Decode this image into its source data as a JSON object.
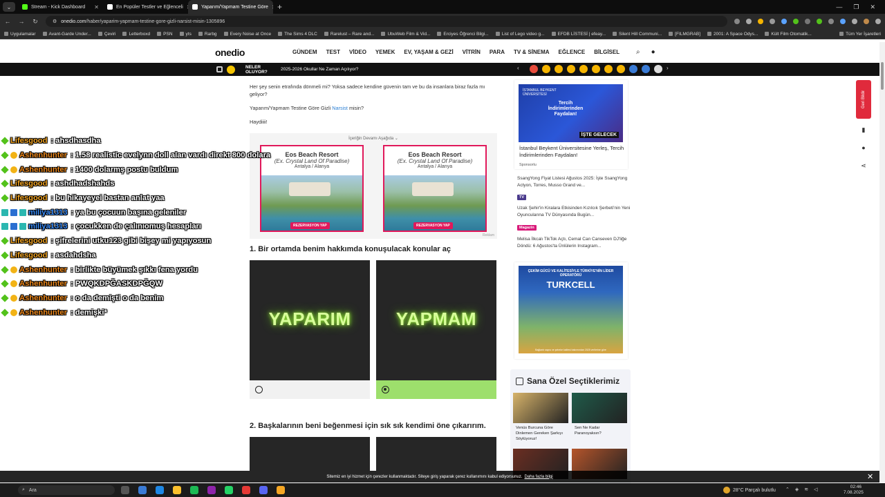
{
  "browser": {
    "tabs": [
      {
        "title": "Stream - Kick Dashboard",
        "color": "#53fc18"
      },
      {
        "title": "En Popüler Testler ve Eğlenceli",
        "color": "#ffffff"
      },
      {
        "title": "Yaparım/Yapmam Testine Göre",
        "color": "#ffffff",
        "active": true
      }
    ],
    "new_tab": "+",
    "address": {
      "host": "onedio.com",
      "path": "/haber/yaparim-yapmam-testine-gore-gizli-narsist-misin-1305896"
    },
    "bookmarks": [
      "Uygulamalar",
      "Avant-Garde Under...",
      "Çeviri",
      "Letterboxd",
      "PSN",
      "yts",
      "Rarbg",
      "Every Noise at Once",
      "The Sims 4 DLC",
      "Rarelust – Rare and...",
      "UbuWeb Film & Vid...",
      "Erciyes Öğrenci Bilgi...",
      "List of Lego video g...",
      "EFDB LİSTESİ | efeay...",
      "Silent Hill Communi...",
      "[FILMGRAB]",
      "2001: A Space Odys...",
      "Kült Film Otomatik..."
    ],
    "bookmarks_right": "Tüm Yer İşaretleri"
  },
  "site": {
    "logo": "onedio",
    "nav": [
      "GÜNDEM",
      "TEST",
      "VİDEO",
      "YEMEK",
      "EV, YAŞAM & GEZİ",
      "VİTRİN",
      "PARA",
      "TV & SİNEMA",
      "EĞLENCE",
      "BİLGİSEL"
    ],
    "ticker_label": "NELER OLUYOR?",
    "ticker_text": "2025-2026 Okullar Ne Zaman Açılıyor?",
    "ticker_emoji_colors": [
      "#e74c3c",
      "#f5b400",
      "#f5b400",
      "#f5b400",
      "#f5b400",
      "#f5b400",
      "#f5b400",
      "#f5b400",
      "#3a7bd5",
      "#3a7bd5",
      "#dddddd"
    ]
  },
  "article": {
    "p1": "Her şey senin etrafında dönmeli mi? Yoksa sadece kendine güvenin tam ve bu da insanlara biraz fazla mı geliyor?",
    "p2_before": "Yaparım/Yapmam Testine Göre Gizli ",
    "p2_link": "Narsist",
    "p2_after": " misin?",
    "p3": "Haydiiii!",
    "ad_continue": "İçeriğin Devamı Aşağıda ⌄",
    "ad": {
      "title": "Eos Beach Resort",
      "subtitle": "(Ex. Crystal Land Of Paradise)",
      "location": "Antalya / Alanya",
      "cta": "REZERVASYON YAP",
      "tag": "Reklam"
    },
    "questions": [
      {
        "title": "1. Bir ortamda benim hakkımda konuşulacak konular aç",
        "options": [
          {
            "label": "YAPARIM",
            "selected": false
          },
          {
            "label": "YAPMAM",
            "selected": true
          }
        ]
      },
      {
        "title": "2. Başkalarının beni beğenmesi için sık sık kendimi öne çıkarırım."
      }
    ]
  },
  "sidebar": {
    "ad1": {
      "badge": "İSTANBUL BEYKENT ÜNİVERSİTESİ",
      "headline": "Tercih İndirimlerinden Faydalan!",
      "stamp": "İŞTE GELECEK",
      "caption": "İstanbul Beykent Üniversitesine Yerleş, Tercih İndirimlerinden Faydalan!",
      "sponsor": "Sponsorlu"
    },
    "items": [
      {
        "text": "SsangYong Fiyat Listesi Ağustos 2025: İşte SsangYong Actyon, Torres, Musso Grand ve..."
      },
      {
        "tag": "TV",
        "tag_color": "#4a3a8c",
        "text": "Uzak Şehir'in Kiralara Etkisinden Kızılcık Şerbeti'nin Yeni Oyuncularına TV Dünyasında Bugün..."
      },
      {
        "tag": "Magazin",
        "tag_color": "#d91a7a",
        "text": "Melisa İlkcalı TikTok Açtı, Cemal Can Canseven DJ'liğe Döndü: 6 Ağustos'ta Ünlülerin Instagram..."
      }
    ],
    "ad2": {
      "top": "ÇEKİM GÜCÜ VE KALİTESİYLE TÜRKİYE'NİN LİDER OPERATÖRÜ",
      "brand": "TURKCELL",
      "foot": "Bağlantı sayısı ve şebeke kalitesi bakımından 2025 verilerine göre"
    },
    "picks_title": "Sana Özel Seçtiklerimiz",
    "picks": [
      {
        "caption": "Venüs Burcuna Göre Dinlemen Gereken Şarkıyı Söylüyoruz!",
        "color": "#d7b36a"
      },
      {
        "caption": "Sen Ne Kadar Paranoyaksın?",
        "color": "#1f5b4a"
      },
      {
        "caption": "",
        "color": "#6b2e22"
      },
      {
        "caption": "",
        "color": "#b5552b"
      }
    ],
    "feedback": "Geri Bildir"
  },
  "chat": [
    {
      "user": "Lifesgood",
      "color": "#f5a623",
      "badges": [
        "green"
      ],
      "msg": ": ahsdhasdha"
    },
    {
      "user": "Ashenhunter",
      "color": "#f08a1c",
      "badges": [
        "green",
        "gold"
      ],
      "msg": ": 1.58 realistic evelynn doll alan vardı direkt 800 dolara"
    },
    {
      "user": "Ashenhunter",
      "color": "#f08a1c",
      "badges": [
        "green",
        "gold"
      ],
      "msg": ": 1400 dolarmş postu buldum"
    },
    {
      "user": "Lifesgood",
      "color": "#f5a623",
      "badges": [
        "green"
      ],
      "msg": ": ashdhadshahds"
    },
    {
      "user": "Lifesgood",
      "color": "#f5a623",
      "badges": [
        "green"
      ],
      "msg": ": bu hikayeyei bastan anlat yaa"
    },
    {
      "user": "miliya1313",
      "color": "#3a8fff",
      "badges": [
        "teal",
        "blue",
        "teal"
      ],
      "msg": ": ya bu çocuun başına geleniler"
    },
    {
      "user": "miliya1313",
      "color": "#3a8fff",
      "badges": [
        "teal",
        "blue",
        "teal"
      ],
      "msg": ": çocukken de çalınıomuş hesapları"
    },
    {
      "user": "Lifesgood",
      "color": "#f5a623",
      "badges": [
        "green"
      ],
      "msg": ": şifrelerini utku123 gibi bişey mi yapıyosun"
    },
    {
      "user": "Lifesgood",
      "color": "#f5a623",
      "badges": [
        "green"
      ],
      "msg": ": asdahdsha"
    },
    {
      "user": "Ashenhunter",
      "color": "#f08a1c",
      "badges": [
        "green",
        "gold"
      ],
      "msg": ": birlikte büyümek şıkkı fena yordu"
    },
    {
      "user": "Ashenhunter",
      "color": "#f08a1c",
      "badges": [
        "green",
        "gold"
      ],
      "msg": ": PWQKDPĞASKDPĞQW"
    },
    {
      "user": "Ashenhunter",
      "color": "#f08a1c",
      "badges": [
        "green",
        "gold"
      ],
      "msg": ": o da demişti o da benim"
    },
    {
      "user": "Ashenhunter",
      "color": "#f08a1c",
      "badges": [
        "green",
        "gold"
      ],
      "msg": ": demişki*"
    }
  ],
  "cookie": {
    "text": "Sitemiz en iyi hizmet için çerezler kullanmaktadır. Siteye giriş yaparak çerez kullanımını kabul ediyorsunuz.",
    "link": "Daha fazla bilgi"
  },
  "taskbar": {
    "search": "Ara",
    "weather": "28°C  Parçalı bulutlu",
    "time": "02:46",
    "date": "7.08.2025",
    "app_colors": [
      "#555555",
      "#3a7bd5",
      "#1e88e5",
      "#fbc02d",
      "#1db954",
      "#8e24aa",
      "#25d366",
      "#e53935",
      "#5865f2",
      "#f5a623"
    ]
  }
}
